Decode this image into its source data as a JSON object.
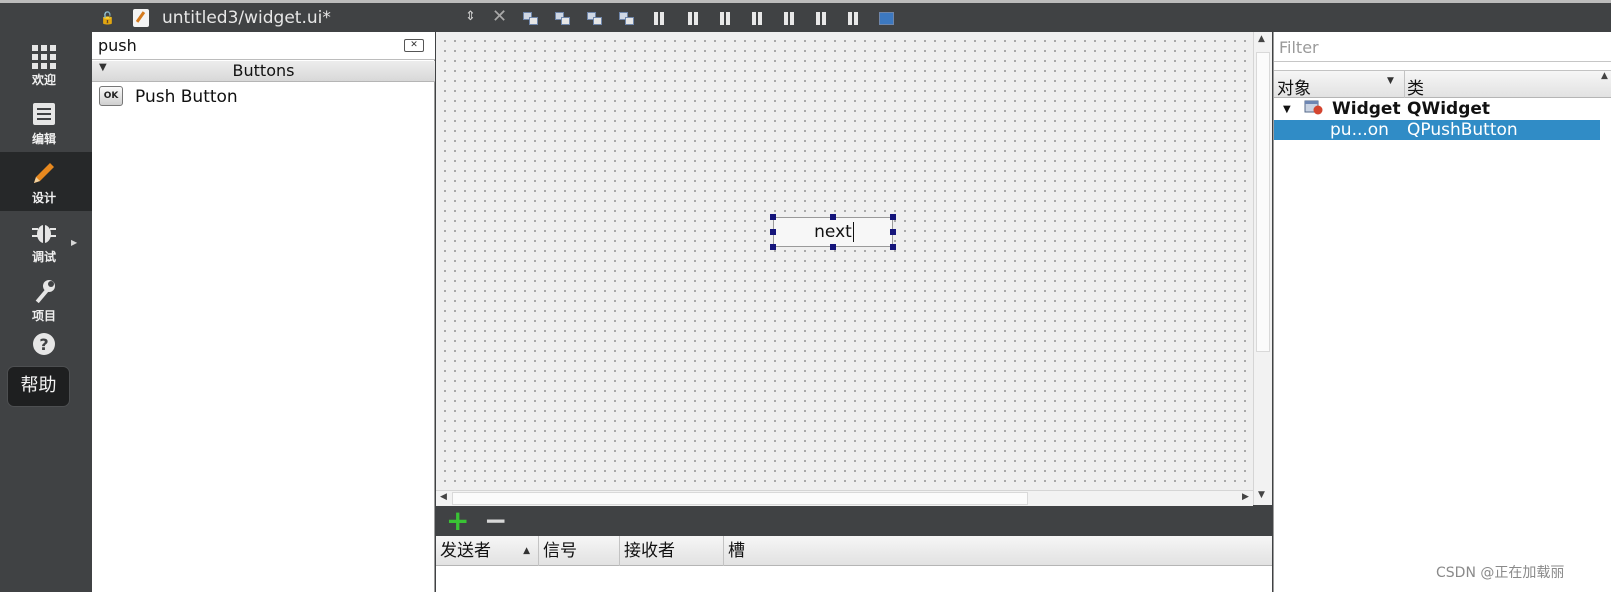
{
  "topbar": {
    "file_title": "untitled3/widget.ui*",
    "toolbar_icons": [
      "edit-widgets-icon",
      "edit-signals-slots-icon",
      "edit-buddies-icon",
      "edit-tab-order-icon",
      "layout-horizontal-icon",
      "layout-vertical-icon",
      "layout-horizontal-splitter-icon",
      "layout-vertical-splitter-icon",
      "layout-form-icon",
      "layout-grid-icon",
      "break-layout-icon",
      "adjust-size-icon"
    ]
  },
  "modes": [
    {
      "label": "欢迎",
      "icon": "welcome-grid-icon"
    },
    {
      "label": "编辑",
      "icon": "edit-document-icon"
    },
    {
      "label": "设计",
      "icon": "design-pencil-icon"
    },
    {
      "label": "调试",
      "icon": "debug-bug-icon"
    },
    {
      "label": "项目",
      "icon": "projects-wrench-icon"
    },
    {
      "label": "帮助",
      "icon": "help-question-icon"
    }
  ],
  "widget_box": {
    "search_value": "push",
    "category": "Buttons",
    "items": [
      {
        "label": "Push Button",
        "icon_text": "OK"
      }
    ]
  },
  "canvas": {
    "selected_widget_text": "next"
  },
  "signal_slot_editor": {
    "columns": [
      "发送者",
      "信号",
      "接收者",
      "槽"
    ]
  },
  "object_inspector": {
    "filter_placeholder": "Filter",
    "columns": [
      "对象",
      "类"
    ],
    "rows": [
      {
        "object": "Widget",
        "class": "QWidget"
      },
      {
        "object": "pu...on",
        "class": "QPushButton"
      }
    ]
  },
  "watermark": "CSDN @正在加载丽"
}
